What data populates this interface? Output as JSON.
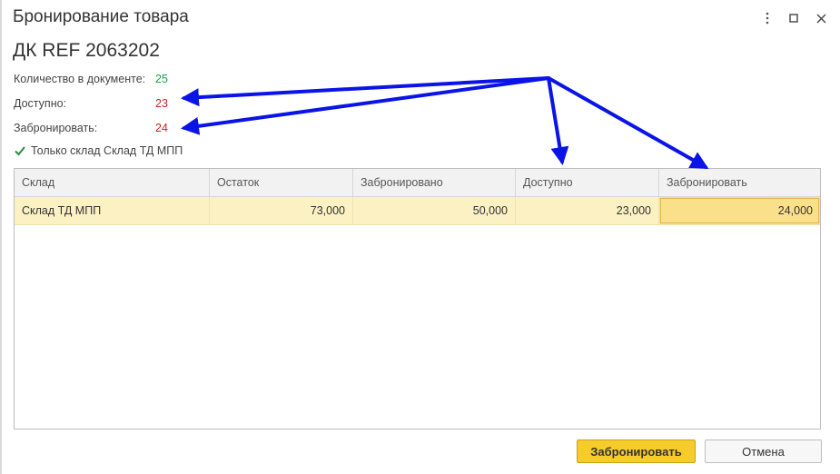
{
  "window": {
    "title": "Бронирование товара",
    "controls": [
      "more-icon",
      "maximize-icon",
      "close-icon"
    ]
  },
  "product": {
    "name": "ДК REF 2063202"
  },
  "fields": {
    "quantity_label": "Количество в документе:",
    "quantity_value": "25",
    "available_label": "Доступно:",
    "available_value": "23",
    "reserve_label": "Забронировать:",
    "reserve_value": "24"
  },
  "checkbox": {
    "label": "Только склад Склад ТД МПП",
    "checked": true
  },
  "table": {
    "columns": [
      "Склад",
      "Остаток",
      "Забронировано",
      "Доступно",
      "Забронировать"
    ],
    "rows": [
      [
        "Склад ТД МПП",
        "73,000",
        "50,000",
        "23,000",
        "24,000"
      ]
    ]
  },
  "buttons": {
    "reserve": "Забронировать",
    "cancel": "Отмена"
  },
  "colors": {
    "value_green": "#1e9e4a",
    "value_red": "#d21f1f",
    "row_highlight": "#fbf1c3",
    "primary_button": "#f6cc2a",
    "annotation_arrow": "#0a14e6"
  }
}
